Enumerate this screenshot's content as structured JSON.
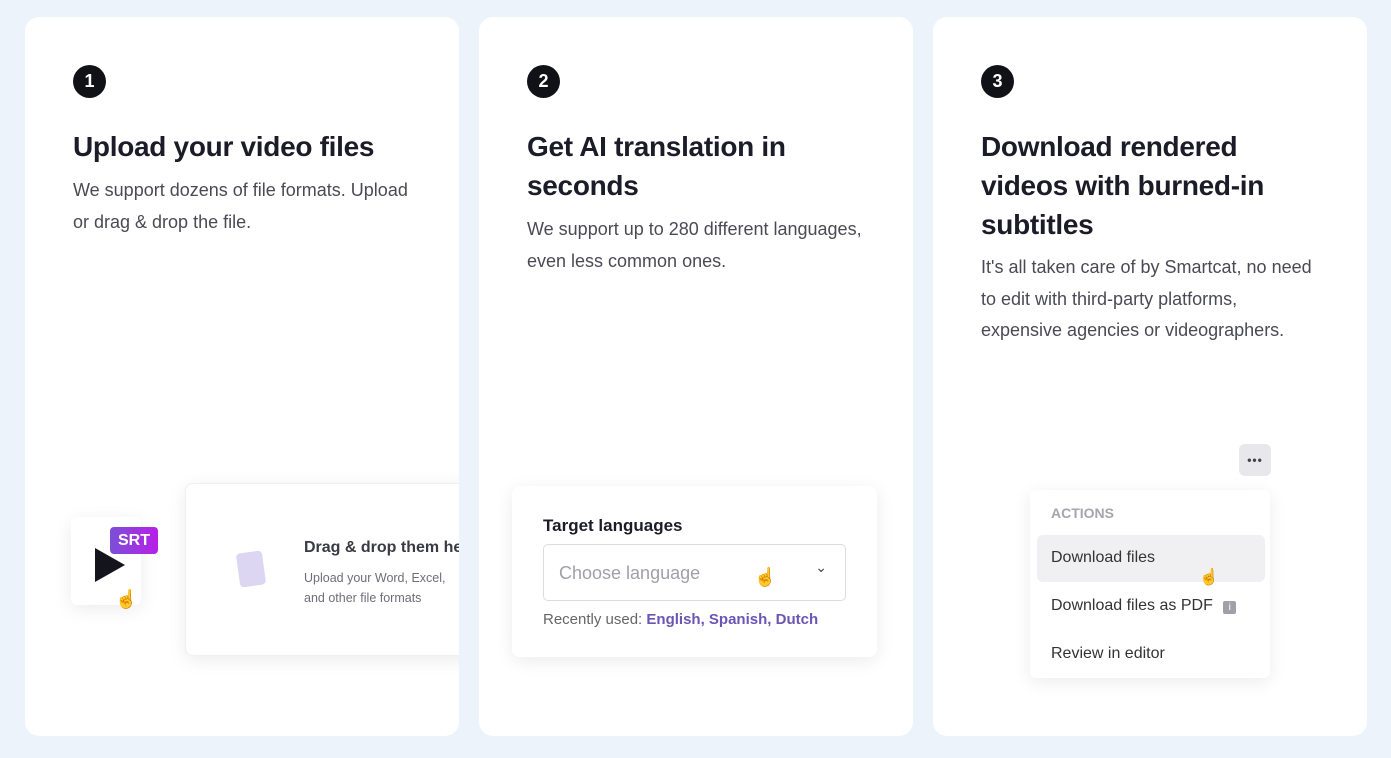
{
  "steps": [
    {
      "number": "1",
      "title": "Upload your video files",
      "description": "We support dozens of file formats. Upload or drag & drop the file."
    },
    {
      "number": "2",
      "title": "Get AI translation in seconds",
      "description": "We support up to 280 different languages, even less common ones."
    },
    {
      "number": "3",
      "title": "Download rendered videos with burned-in subtitles",
      "description": "It's all taken care of by Smartcat, no need to edit with third-party platforms, expensive agencies or videographers."
    }
  ],
  "upload": {
    "badge": "SRT",
    "drop_title": "Drag & drop them here",
    "drop_sub": "Upload your Word, Excel, and other file formats"
  },
  "languages": {
    "label": "Target languages",
    "placeholder": "Choose language",
    "recent_label": "Recently used:",
    "recent": [
      "English",
      "Spanish",
      "Dutch"
    ]
  },
  "actions": {
    "header": "ACTIONS",
    "items": [
      "Download files",
      "Download files as PDF",
      "Review in editor"
    ]
  },
  "colors": {
    "accent": "#6b55b5",
    "badge": "#9b2fe0",
    "background": "#edf3fb"
  }
}
